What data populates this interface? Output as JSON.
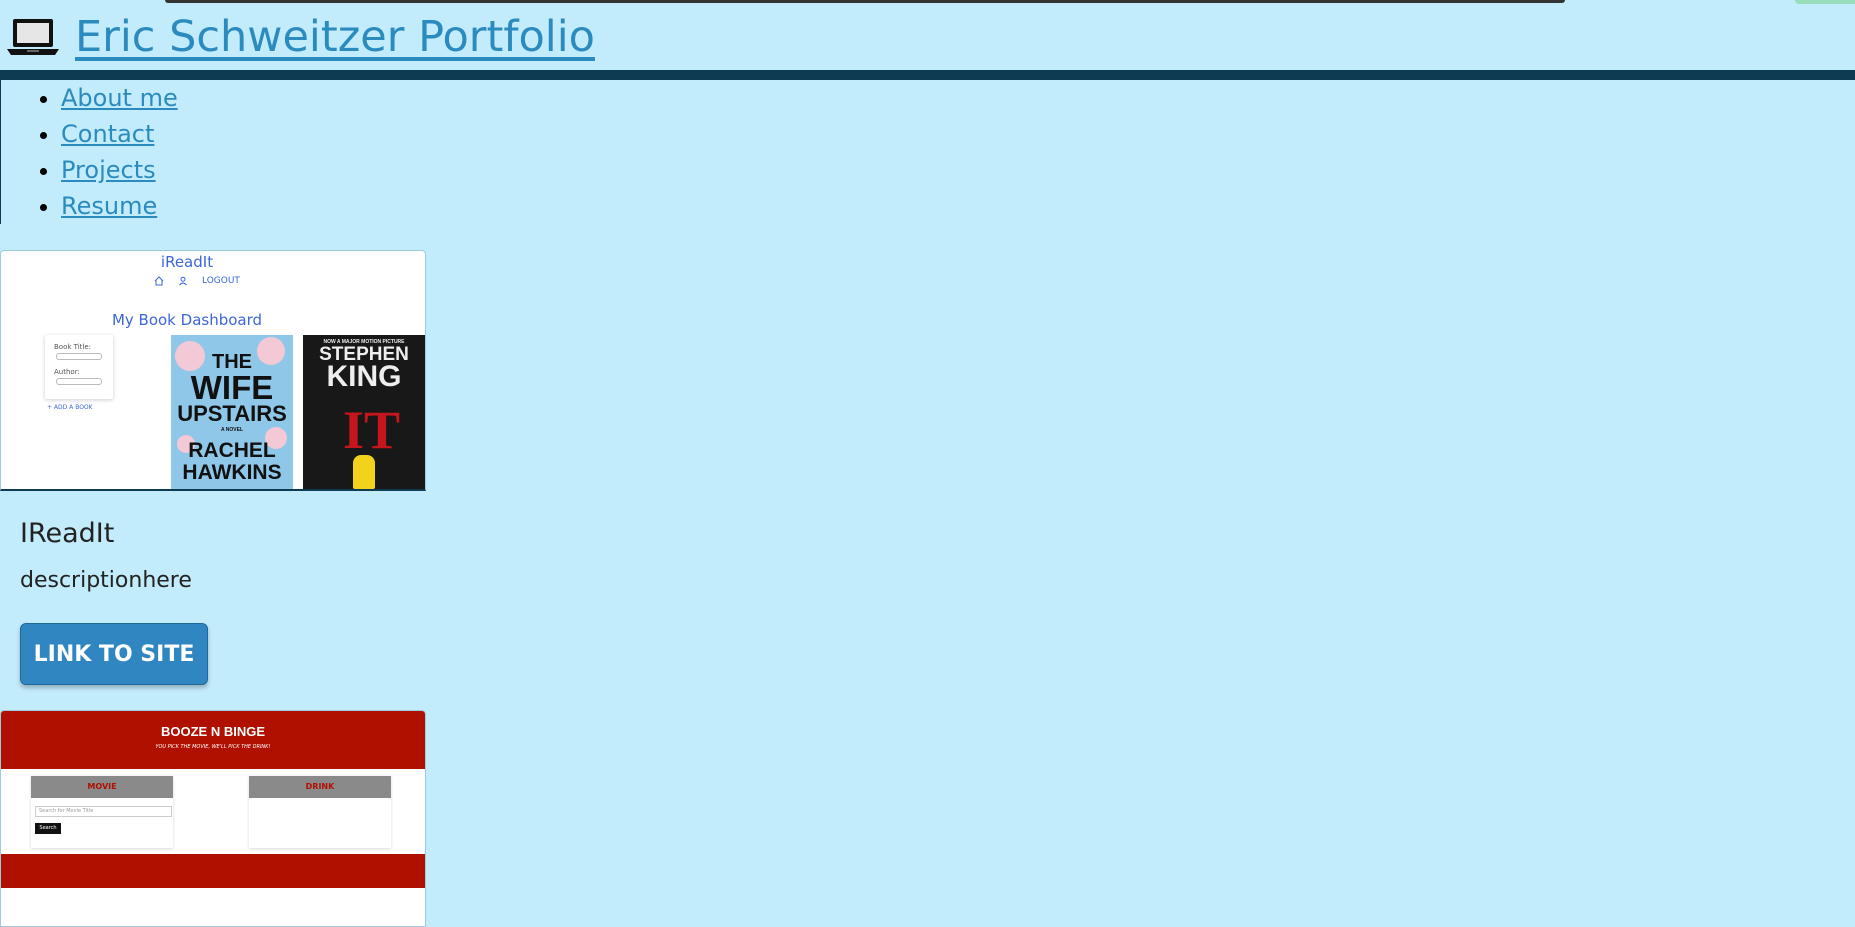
{
  "header": {
    "title": "Eric Schweitzer Portfolio",
    "icon": "laptop-icon"
  },
  "nav": {
    "items": [
      {
        "label": "About me"
      },
      {
        "label": "Contact"
      },
      {
        "label": "Projects"
      },
      {
        "label": "Resume"
      }
    ]
  },
  "projects": [
    {
      "title": "IReadIt",
      "description": "descriptionhere",
      "button_label": "LINK TO SITE",
      "preview": {
        "app_title": "iReadIt",
        "dashboard_heading": "My Book Dashboard",
        "nav_logout": "LOGOUT",
        "book_title_label": "Book Title:",
        "author_label": "Author:",
        "add_book": "+ ADD A BOOK",
        "cover1": {
          "line1": "THE",
          "line2": "WIFE",
          "line3": "UPSTAIRS",
          "line4": "A NOVEL",
          "line5": "RACHEL",
          "line6": "HAWKINS"
        },
        "cover2": {
          "tagline": "NOW A MAJOR MOTION PICTURE",
          "line1": "STEPHEN",
          "line2": "KING",
          "line3": "IT"
        }
      }
    },
    {
      "preview": {
        "app_title": "BOOZE N BINGE",
        "subtitle": "YOU PICK THE MOVIE, WE'LL PICK THE DRINK!",
        "movie_label": "MOVIE",
        "drink_label": "DRINK",
        "search_placeholder": "Search for Movie Title",
        "search_button": "Search"
      }
    }
  ]
}
